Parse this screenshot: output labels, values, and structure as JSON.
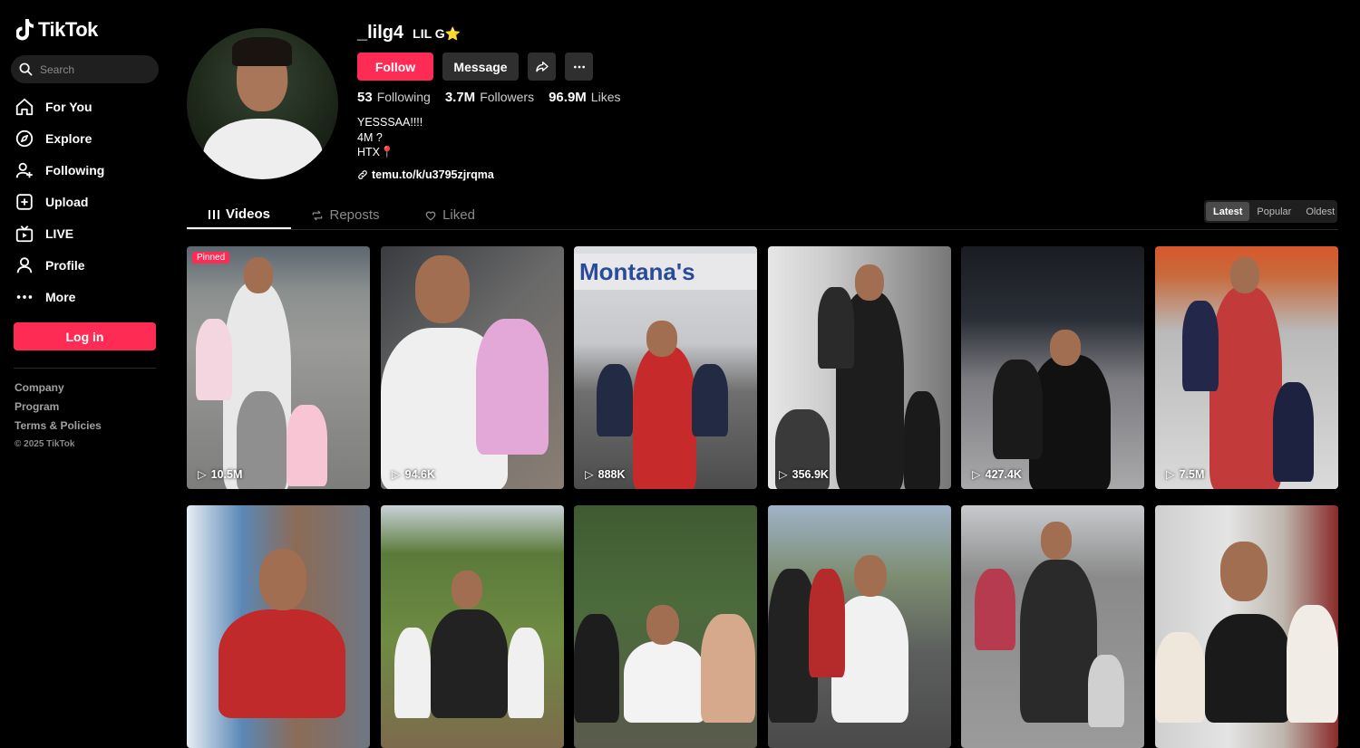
{
  "app": {
    "name": "TikTok"
  },
  "search": {
    "placeholder": "Search"
  },
  "nav": [
    {
      "label": "For You",
      "icon": "home-icon"
    },
    {
      "label": "Explore",
      "icon": "compass-icon"
    },
    {
      "label": "Following",
      "icon": "user-follow-icon"
    },
    {
      "label": "Upload",
      "icon": "upload-icon"
    },
    {
      "label": "LIVE",
      "icon": "live-tv-icon"
    },
    {
      "label": "Profile",
      "icon": "profile-icon"
    },
    {
      "label": "More",
      "icon": "more-dots-icon"
    }
  ],
  "login_label": "Log in",
  "footer": {
    "links": [
      "Company",
      "Program",
      "Terms & Policies"
    ],
    "copyright": "© 2025 TikTok"
  },
  "profile": {
    "handle": "_lilg4",
    "nickname": "LIL G⭐",
    "follow_label": "Follow",
    "message_label": "Message",
    "stats": [
      {
        "value": "53",
        "label": "Following"
      },
      {
        "value": "3.7M",
        "label": "Followers"
      },
      {
        "value": "96.9M",
        "label": "Likes"
      }
    ],
    "bio": [
      "YESSSAA!!!!",
      "4M ?",
      "HTX📍"
    ],
    "link": "temu.to/k/u3795zjrqma"
  },
  "tabs": [
    "Videos",
    "Reposts",
    "Liked"
  ],
  "sort": [
    "Latest",
    "Popular",
    "Oldest"
  ],
  "videos": [
    {
      "views": "10.5M",
      "pinned": "Pinned"
    },
    {
      "views": "94.6K"
    },
    {
      "views": "888K",
      "sign": "Montana's"
    },
    {
      "views": "356.9K"
    },
    {
      "views": "427.4K"
    },
    {
      "views": "7.5M"
    },
    {
      "views": ""
    },
    {
      "views": ""
    },
    {
      "views": ""
    },
    {
      "views": ""
    },
    {
      "views": ""
    },
    {
      "views": ""
    }
  ],
  "colors": {
    "accent": "#fe2c55",
    "background": "#000000",
    "surface": "#2f2f2f"
  }
}
